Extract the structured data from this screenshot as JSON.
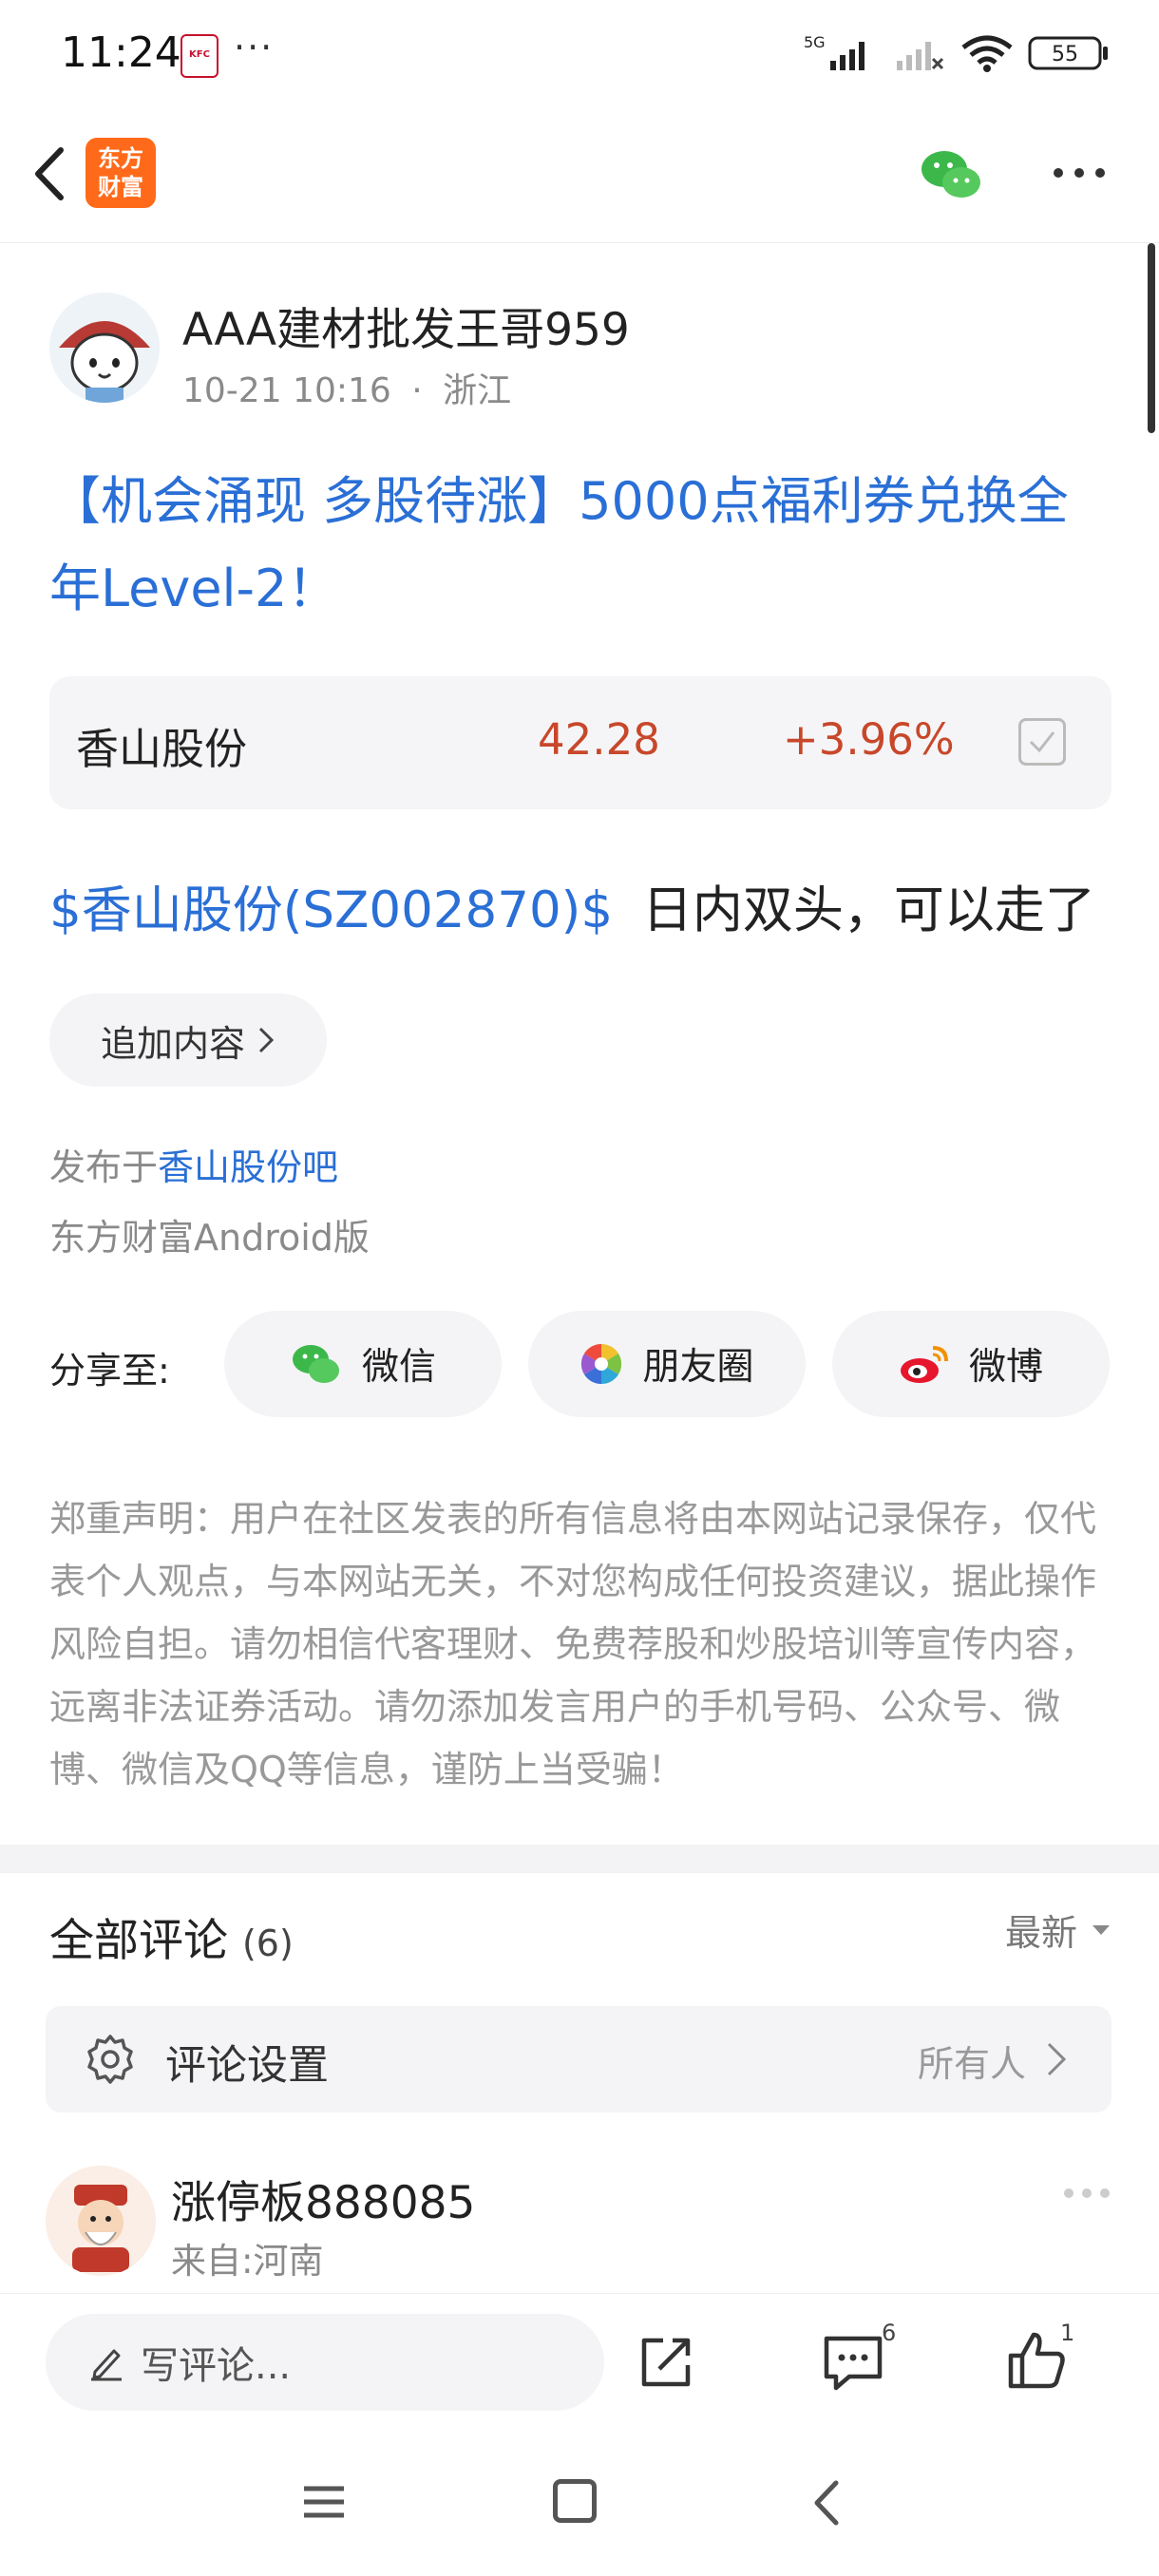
{
  "status_bar": {
    "time": "11:24",
    "notif_more": "···",
    "network": "5G",
    "battery": "55"
  },
  "nav": {
    "logo_line1": "东方",
    "logo_line2": "财富"
  },
  "post": {
    "author": "AAA建材批发王哥959",
    "date": "10-21 10:16",
    "separator": "·",
    "location": "浙江",
    "title": "【机会涌现 多股待涨】5000点福利券兑换全年Level-2！",
    "stock": {
      "name": "香山股份",
      "price": "42.28",
      "change": "+3.96%"
    },
    "body_stock_link": "$香山股份(SZ002870)$",
    "body_text": "日内双头，可以走了",
    "add_content_label": "追加内容",
    "published_prefix": "发布于",
    "published_forum": "香山股份吧",
    "client": "东方财富Android版"
  },
  "share": {
    "label": "分享至:",
    "wechat": "微信",
    "moments": "朋友圈",
    "weibo": "微博"
  },
  "disclaimer": "郑重声明：用户在社区发表的所有信息将由本网站记录保存，仅代表个人观点，与本网站无关，不对您构成任何投资建议，据此操作风险自担。请勿相信代客理财、免费荐股和炒股培训等宣传内容，远离非法证券活动。请勿添加发言用户的手机号码、公众号、微博、微信及QQ等信息，谨防上当受骗！",
  "comments": {
    "title": "全部评论",
    "count": "(6)",
    "sort": "最新",
    "settings_label": "评论设置",
    "settings_value": "所有人",
    "first": {
      "name": "涨停板888085",
      "location": "来自:河南"
    }
  },
  "bottom_bar": {
    "placeholder": "写评论...",
    "comment_count": "6",
    "like_count": "1"
  },
  "colors": {
    "link_blue": "#2a6fd6",
    "price_red": "#c8472a",
    "brand_orange": "#ff6a1a"
  }
}
